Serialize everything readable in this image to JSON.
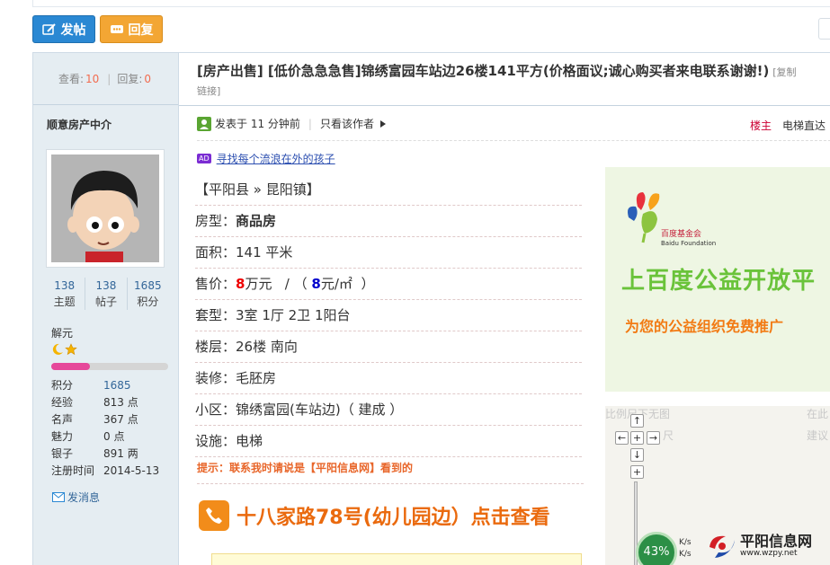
{
  "toolbar": {
    "post_label": "发帖",
    "reply_label": "回复"
  },
  "thread_stats": {
    "views_label": "查看:",
    "views": "10",
    "replies_label": "回复:",
    "replies": "0"
  },
  "post": {
    "title": "[房产出售] [低价急急急售]锦绣富园车站边26楼141平方(价格面议;诚心购买者来电联系谢谢!)",
    "copy_link_a": "[复制",
    "copy_link_b": "链接]",
    "posted_label": "发表于 11 分钟前",
    "only_author_label": "只看该作者",
    "floor_label": "楼主",
    "elevator_label": "电梯直达",
    "ad_badge": "AD",
    "ad_text": "寻找每个流浪在外的孩子"
  },
  "author": {
    "name": "顺意房产中介",
    "stats": [
      {
        "value": "138",
        "label": "主题"
      },
      {
        "value": "138",
        "label": "帖子"
      },
      {
        "value": "1685",
        "label": "积分"
      }
    ],
    "rank": "解元",
    "level_progress": 0.33,
    "profile": [
      {
        "key": "积分",
        "value": "1685",
        "link": true
      },
      {
        "key": "经验",
        "value": "813 点",
        "link": false
      },
      {
        "key": "名声",
        "value": "367 点",
        "link": false
      },
      {
        "key": "魅力",
        "value": "0 点",
        "link": false
      },
      {
        "key": "银子",
        "value": "891 两",
        "link": false
      },
      {
        "key": "注册时间",
        "value": "2014-5-13",
        "link": false
      }
    ],
    "message_label": "发消息"
  },
  "listing": {
    "location": "【平阳县 » 昆阳镇】",
    "type_label": "房型：",
    "type_value": "商品房",
    "area_label": "面积：",
    "area_value": "141 平米",
    "price_label": "售价：",
    "price_value": "8",
    "price_unit": "万元",
    "price_sep": "/ （",
    "unit_price_value": "8",
    "unit_price_unit": "元/㎡",
    "price_close": "）",
    "layout_label": "套型：",
    "layout_value": "3室 1厅 2卫 1阳台",
    "floor_label": "楼层：",
    "floor_value": "26楼 南向",
    "decor_label": "装修：",
    "decor_value": "毛胚房",
    "community_label": "小区：",
    "community_value": "锦绣富园(车站边)（ 建成 ）",
    "facility_label": "设施：",
    "facility_value": "电梯",
    "tip": "提示：联系我时请说是【平阳信息网】看到的",
    "phone_text": "十八家路78号(幼儿园边）点击查看"
  },
  "banner": {
    "logo_text": "百度基金会",
    "logo_sub": "Baidu Foundation",
    "headline": "上百度公益开放平",
    "subline": "为您的公益组织免费推广"
  },
  "map": {
    "scale_text": "比例尺下无图",
    "scale_text2": "尺",
    "right_text1": "在此",
    "right_text2": "建议",
    "zoom_percent": "43%",
    "speed_up": "K/s",
    "speed_down": "K/s"
  },
  "watermark": {
    "name": "平阳信息网",
    "url": "www.wzpy.net"
  },
  "colors": {
    "accent_blue": "#2a88d3",
    "accent_orange": "#f3a634",
    "price_red": "#ee0000",
    "tip_orange": "#e8662a"
  }
}
